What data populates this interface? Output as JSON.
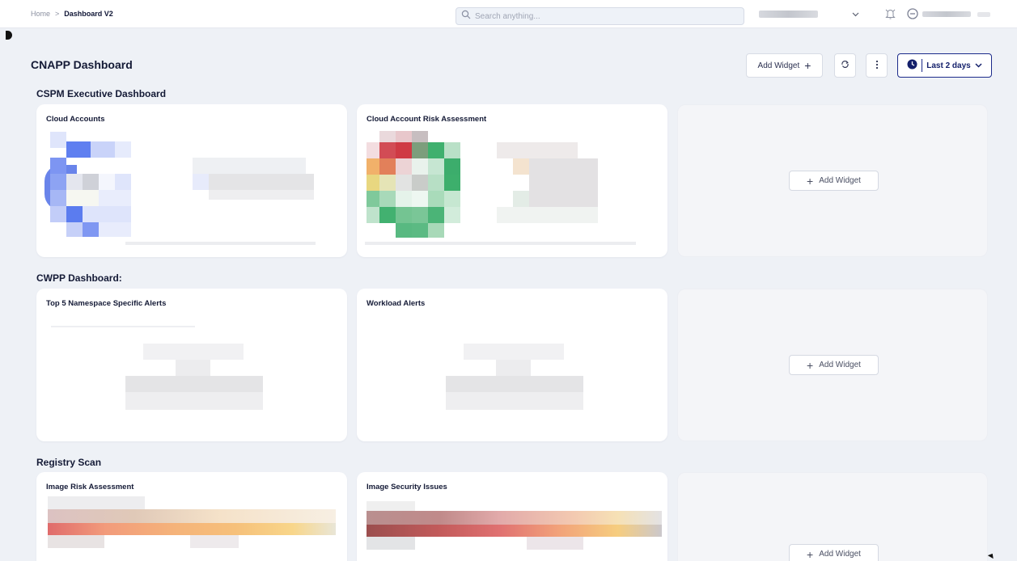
{
  "breadcrumb": {
    "home": "Home",
    "separator": ">",
    "current": "Dashboard V2"
  },
  "search": {
    "placeholder": "Search anything..."
  },
  "header": {
    "title": "CNAPP Dashboard",
    "add_widget_label": "Add Widget",
    "time_range_label": "Last 2 days"
  },
  "icons": {
    "search": "search-icon",
    "chevron": "chevron-down-icon",
    "bell": "bell-icon",
    "user": "user-icon",
    "refresh": "refresh-icon",
    "more": "more-vertical-icon",
    "clock": "clock-icon",
    "plus": "plus-icon"
  },
  "colors": {
    "accent": "#1b2a8a",
    "page_bg": "#eef1f6",
    "card_bg": "#ffffff"
  },
  "sections": [
    {
      "title": "CSPM Executive Dashboard",
      "cards": [
        "Cloud Accounts",
        "Cloud Account Risk Assessment"
      ],
      "add_label": "Add Widget"
    },
    {
      "title": "CWPP Dashboard:",
      "cards": [
        "Top 5 Namespace Specific Alerts",
        "Workload Alerts"
      ],
      "add_label": "Add Widget"
    },
    {
      "title": "Registry Scan",
      "cards": [
        "Image Risk Assessment",
        "Image Security Issues"
      ],
      "add_label": "Add Widget"
    }
  ]
}
